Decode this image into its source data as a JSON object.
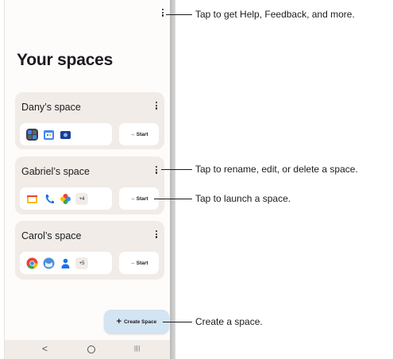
{
  "screen": {
    "title": "Your spaces",
    "spaces": [
      {
        "name": "Dany’s space",
        "start_label": "→ Start",
        "apps": [
          "multi-app-icon",
          "calendar-icon",
          "gallery-icon"
        ],
        "more": ""
      },
      {
        "name": "Gabriel’s space",
        "start_label": "→ Start",
        "apps": [
          "slides-icon",
          "phone-icon",
          "pinwheel-icon"
        ],
        "more": "+4"
      },
      {
        "name": "Carol’s space",
        "start_label": "→ Start",
        "apps": [
          "chrome-icon",
          "weather-icon",
          "contacts-icon"
        ],
        "more": "+5"
      }
    ],
    "fab": {
      "plus": "+",
      "label": "Create Space"
    },
    "nav": {
      "back": "<",
      "recent": "|||"
    }
  },
  "callouts": {
    "top_menu": "Tap to get Help, Feedback, and more.",
    "space_menu": "Tap to rename, edit, or delete a space.",
    "start": "Tap to launch a space.",
    "create": "Create a space."
  },
  "colors": {
    "card_bg": "#f1ece7",
    "fab_bg": "#d3e4f2",
    "accent_blue": "#1a73e8"
  }
}
